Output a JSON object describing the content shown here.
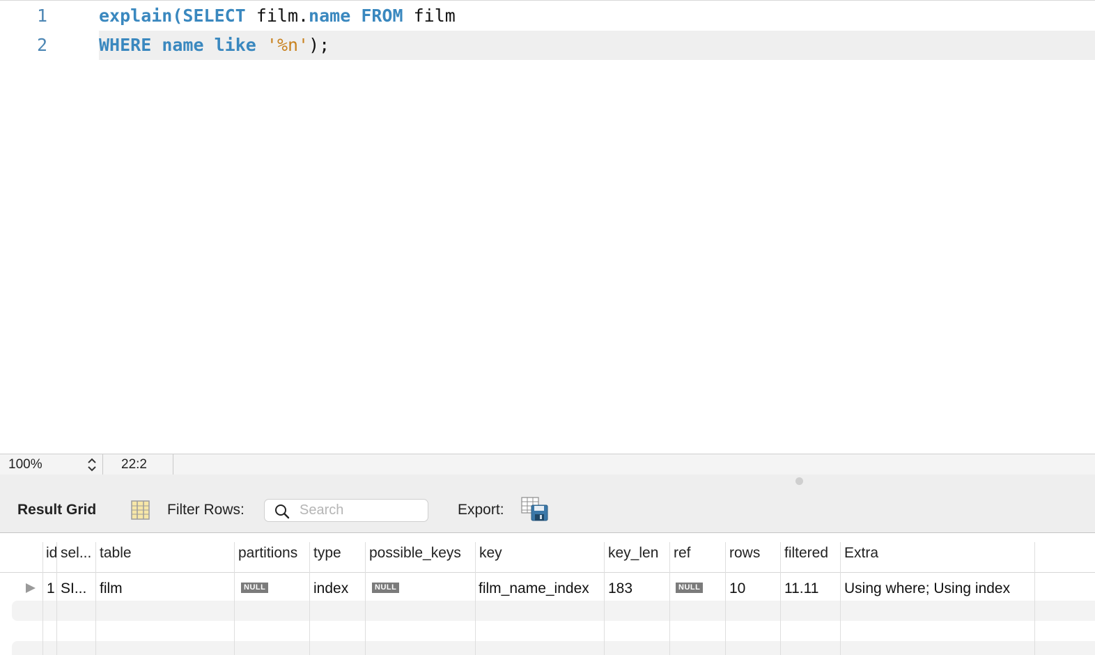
{
  "editor": {
    "lines": [
      {
        "number": "1",
        "tokens": [
          {
            "t": "explain",
            "c": "kw"
          },
          {
            "t": "(",
            "c": "kw"
          },
          {
            "t": "SELECT",
            "c": "kw"
          },
          {
            "t": " film.",
            "c": ""
          },
          {
            "t": "name",
            "c": "kw"
          },
          {
            "t": " ",
            "c": ""
          },
          {
            "t": "FROM",
            "c": "kw"
          },
          {
            "t": " film",
            "c": ""
          }
        ]
      },
      {
        "number": "2",
        "tokens": [
          {
            "t": "WHERE",
            "c": "kw"
          },
          {
            "t": " ",
            "c": ""
          },
          {
            "t": "name",
            "c": "kw"
          },
          {
            "t": " ",
            "c": ""
          },
          {
            "t": "like",
            "c": "kw"
          },
          {
            "t": " ",
            "c": ""
          },
          {
            "t": "'%n'",
            "c": "str"
          },
          {
            "t": ");",
            "c": ""
          }
        ]
      }
    ]
  },
  "status": {
    "zoom": "100%",
    "cursor_position": "22:2"
  },
  "result_toolbar": {
    "title": "Result Grid",
    "filter_label": "Filter Rows:",
    "search_placeholder": "Search",
    "export_label": "Export:"
  },
  "grid": {
    "columns": [
      "id",
      "sel...",
      "table",
      "partitions",
      "type",
      "possible_keys",
      "key",
      "key_len",
      "ref",
      "rows",
      "filtered",
      "Extra"
    ],
    "rows": [
      [
        "1",
        "SI...",
        "film",
        "NULL",
        "index",
        "NULL",
        "film_name_index",
        "183",
        "NULL",
        "10",
        "11.11",
        "Using where; Using index"
      ]
    ]
  },
  "colors": {
    "keyword": "#3a88bf",
    "string": "#c9821f",
    "line_number": "#4c86b4",
    "current_line": "#efefef"
  }
}
